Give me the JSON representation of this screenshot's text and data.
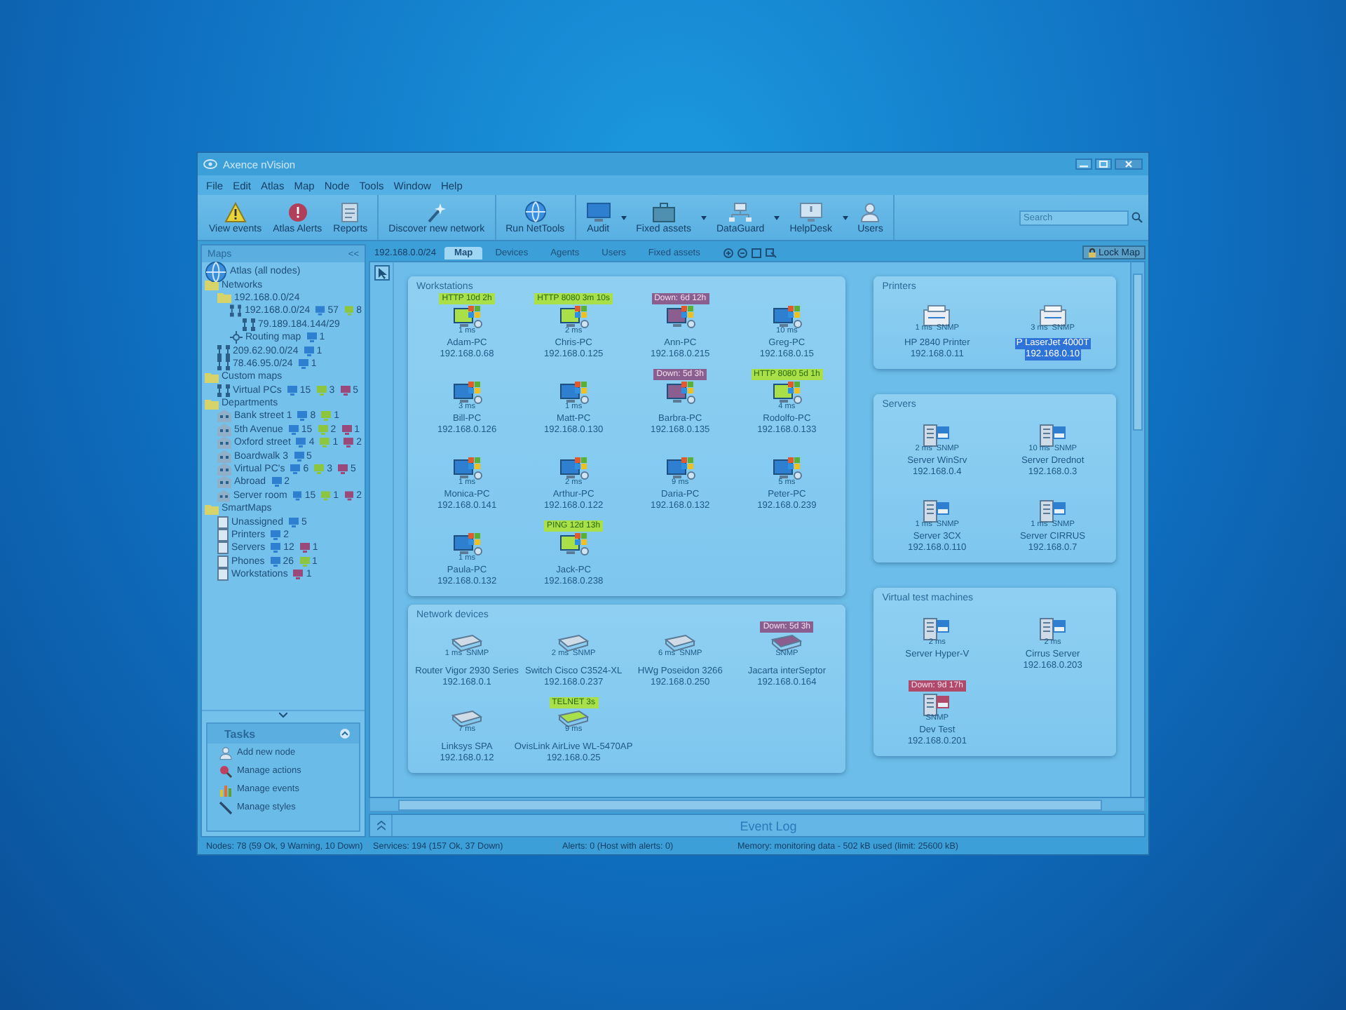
{
  "window": {
    "title": "Axence nVision"
  },
  "menu": [
    "File",
    "Edit",
    "Atlas",
    "Map",
    "Node",
    "Tools",
    "Window",
    "Help"
  ],
  "toolbar": [
    {
      "buttons": [
        {
          "label": "View events",
          "dropdown": false
        },
        {
          "label": "Atlas Alerts",
          "dropdown": false
        },
        {
          "label": "Reports",
          "dropdown": false
        }
      ]
    },
    {
      "buttons": [
        {
          "label": "Discover new network",
          "dropdown": false
        }
      ]
    },
    {
      "buttons": [
        {
          "label": "Run NetTools",
          "dropdown": false
        }
      ]
    },
    {
      "buttons": [
        {
          "label": "Audit",
          "dropdown": true
        },
        {
          "label": "Fixed assets",
          "dropdown": true
        },
        {
          "label": "DataGuard",
          "dropdown": true
        },
        {
          "label": "HelpDesk",
          "dropdown": true
        },
        {
          "label": "Users",
          "dropdown": false
        }
      ]
    }
  ],
  "search": {
    "placeholder": "Search"
  },
  "sidebar": {
    "title": "Maps",
    "collapse": "<<",
    "tree": [
      {
        "label": "Atlas (all nodes)",
        "kind": "globe"
      },
      {
        "label": "Networks",
        "kind": "folder",
        "children": [
          {
            "label": "192.168.0.0/24",
            "kind": "folder",
            "children": [
              {
                "label": "192.168.0.0/24",
                "kind": "net",
                "counts": [
                  {
                    "value": "57",
                    "color": "#2f7fd0"
                  },
                  {
                    "value": "8",
                    "color": "#8cc63f"
                  }
                ],
                "children": [
                  {
                    "label": "79.189.184.144/29",
                    "kind": "net"
                  }
                ]
              },
              {
                "label": "Routing map",
                "kind": "routing",
                "counts": [
                  {
                    "value": "1",
                    "color": "#2f7fd0"
                  }
                ]
              }
            ]
          },
          {
            "label": "209.62.90.0/24",
            "kind": "net",
            "counts": [
              {
                "value": "1",
                "color": "#2f7fd0"
              }
            ]
          },
          {
            "label": "78.46.95.0/24",
            "kind": "net",
            "counts": [
              {
                "value": "1",
                "color": "#2f7fd0"
              }
            ]
          }
        ]
      },
      {
        "label": "Custom maps",
        "kind": "folder",
        "children": [
          {
            "label": "Virtual PCs",
            "kind": "net",
            "counts": [
              {
                "value": "15",
                "color": "#2f7fd0"
              },
              {
                "value": "3",
                "color": "#8cc63f"
              },
              {
                "value": "5",
                "color": "#9a4a7a"
              }
            ]
          }
        ]
      },
      {
        "label": "Departments",
        "kind": "folder",
        "children": [
          {
            "label": "Bank street 1",
            "kind": "building",
            "counts": [
              {
                "value": "8",
                "color": "#2f7fd0"
              },
              {
                "value": "1",
                "color": "#8cc63f"
              }
            ]
          },
          {
            "label": "5th Avenue",
            "kind": "building",
            "counts": [
              {
                "value": "15",
                "color": "#2f7fd0"
              },
              {
                "value": "2",
                "color": "#8cc63f"
              },
              {
                "value": "1",
                "color": "#9a4a7a"
              }
            ]
          },
          {
            "label": "Oxford street",
            "kind": "building",
            "counts": [
              {
                "value": "4",
                "color": "#2f7fd0"
              },
              {
                "value": "1",
                "color": "#8cc63f"
              },
              {
                "value": "2",
                "color": "#9a4a7a"
              }
            ]
          },
          {
            "label": "Boardwalk 3",
            "kind": "building",
            "counts": [
              {
                "value": "5",
                "color": "#2f7fd0"
              }
            ]
          },
          {
            "label": "Virtual PC's",
            "kind": "building",
            "counts": [
              {
                "value": "6",
                "color": "#2f7fd0"
              },
              {
                "value": "3",
                "color": "#8cc63f"
              },
              {
                "value": "5",
                "color": "#9a4a7a"
              }
            ]
          },
          {
            "label": "Abroad",
            "kind": "building",
            "counts": [
              {
                "value": "2",
                "color": "#2f7fd0"
              }
            ]
          },
          {
            "label": "Server room",
            "kind": "building",
            "counts": [
              {
                "value": "15",
                "color": "#2f7fd0"
              },
              {
                "value": "1",
                "color": "#8cc63f"
              },
              {
                "value": "2",
                "color": "#9a4a7a"
              }
            ]
          }
        ]
      },
      {
        "label": "SmartMaps",
        "kind": "folder",
        "children": [
          {
            "label": "Unassigned",
            "kind": "page",
            "counts": [
              {
                "value": "5",
                "color": "#2f7fd0"
              }
            ]
          },
          {
            "label": "Printers",
            "kind": "page",
            "counts": [
              {
                "value": "2",
                "color": "#2f7fd0"
              }
            ]
          },
          {
            "label": "Servers",
            "kind": "page",
            "counts": [
              {
                "value": "12",
                "color": "#2f7fd0"
              },
              {
                "value": "1",
                "color": "#9a4a7a"
              }
            ]
          },
          {
            "label": "Phones",
            "kind": "page",
            "counts": [
              {
                "value": "26",
                "color": "#2f7fd0"
              },
              {
                "value": "1",
                "color": "#8cc63f"
              }
            ]
          },
          {
            "label": "Workstations",
            "kind": "page",
            "counts": [
              {
                "value": "1",
                "color": "#9a4a7a"
              }
            ]
          }
        ]
      }
    ]
  },
  "tasks": {
    "title": "Tasks",
    "items": [
      "Add new node",
      "Manage actions",
      "Manage events",
      "Manage styles"
    ]
  },
  "map": {
    "path": "192.168.0.0/24",
    "tabs": [
      {
        "label": "Map",
        "selected": true
      },
      {
        "label": "Devices",
        "selected": false
      },
      {
        "label": "Agents",
        "selected": false
      },
      {
        "label": "Users",
        "selected": false
      },
      {
        "label": "Fixed assets",
        "selected": false
      }
    ],
    "lock_button": "Lock Map",
    "columns": [
      {
        "groups": [
          {
            "title": "Workstations",
            "nodes": [
              {
                "name": "Adam-PC",
                "ip": "192.168.0.68",
                "ping": "1 ms",
                "badge": {
                  "text": "HTTP 10d 2h",
                  "color": "#a9e04a"
                },
                "kind": "workstation",
                "selected": false
              },
              {
                "name": "Chris-PC",
                "ip": "192.168.0.125",
                "ping": "2 ms",
                "badge": {
                  "text": "HTTP 8080 3m 10s",
                  "color": "#a9e04a"
                },
                "kind": "workstation",
                "selected": false
              },
              {
                "name": "Ann-PC",
                "ip": "192.168.0.215",
                "badge": {
                  "text": "Down: 6d 12h",
                  "color": "#8a5f8f"
                },
                "kind": "workstation",
                "selected": false
              },
              {
                "name": "Greg-PC",
                "ip": "192.168.0.15",
                "ping": "10 ms",
                "kind": "workstation",
                "selected": false
              },
              {
                "name": "Bill-PC",
                "ip": "192.168.0.126",
                "ping": "3 ms",
                "kind": "workstation",
                "selected": false
              },
              {
                "name": "Matt-PC",
                "ip": "192.168.0.130",
                "ping": "1 ms",
                "kind": "workstation",
                "selected": false
              },
              {
                "name": "Barbra-PC",
                "ip": "192.168.0.135",
                "badge": {
                  "text": "Down: 5d 3h",
                  "color": "#8a5f8f"
                },
                "kind": "workstation",
                "selected": false
              },
              {
                "name": "Rodolfo-PC",
                "ip": "192.168.0.133",
                "ping": "4 ms",
                "badge": {
                  "text": "HTTP 8080 5d 1h",
                  "color": "#a9e04a"
                },
                "kind": "workstation",
                "selected": false
              },
              {
                "name": "Monica-PC",
                "ip": "192.168.0.141",
                "ping": "1 ms",
                "kind": "workstation",
                "selected": false
              },
              {
                "name": "Arthur-PC",
                "ip": "192.168.0.122",
                "ping": "2 ms",
                "kind": "workstation",
                "selected": false
              },
              {
                "name": "Daria-PC",
                "ip": "192.168.0.132",
                "ping": "9 ms",
                "kind": "workstation",
                "selected": false
              },
              {
                "name": "Peter-PC",
                "ip": "192.168.0.239",
                "ping": "5 ms",
                "kind": "workstation",
                "selected": false
              },
              {
                "name": "Paula-PC",
                "ip": "192.168.0.132",
                "ping": "1 ms",
                "kind": "workstation",
                "selected": false
              },
              {
                "name": "Jack-PC",
                "ip": "192.168.0.238",
                "badge": {
                  "text": "PING 12d 13h",
                  "color": "#a9e04a"
                },
                "kind": "workstation",
                "selected": false
              }
            ]
          },
          {
            "title": "Network devices",
            "nodes": [
              {
                "name": "Router Vigor 2930 Series",
                "ip": "192.168.0.1",
                "ping": "1 ms",
                "tag": "SNMP",
                "kind": "router",
                "selected": false
              },
              {
                "name": "Switch Cisco C3524-XL",
                "ip": "192.168.0.237",
                "ping": "2 ms",
                "tag": "SNMP",
                "kind": "router",
                "selected": false
              },
              {
                "name": "HWg Poseidon 3266",
                "ip": "192.168.0.250",
                "ping": "6 ms",
                "tag": "SNMP",
                "kind": "router",
                "selected": false
              },
              {
                "name": "Jacarta interSeptor",
                "ip": "192.168.0.164",
                "tag": "SNMP",
                "badge": {
                  "text": "Down: 5d 3h",
                  "color": "#8a5f8f"
                },
                "kind": "router",
                "selected": false
              },
              {
                "name": "Linksys SPA",
                "ip": "192.168.0.12",
                "ping": "7 ms",
                "kind": "router",
                "selected": false
              },
              {
                "name": "OvisLink AirLive WL-5470AP",
                "ip": "192.168.0.25",
                "ping": "9 ms",
                "badge": {
                  "text": "TELNET 3s",
                  "color": "#a9e04a"
                },
                "kind": "router",
                "selected": false
              }
            ]
          }
        ]
      },
      {
        "groups": [
          {
            "title": "Printers",
            "nodes": [
              {
                "name": "HP 2840 Printer",
                "ip": "192.168.0.11",
                "ping": "1 ms",
                "tag": "SNMP",
                "kind": "printer",
                "selected": false
              },
              {
                "name": "P LaserJet 4000T",
                "ip": "192.168.0.10",
                "ping": "3 ms",
                "tag": "SNMP",
                "kind": "printer",
                "selected": true
              }
            ]
          },
          {
            "title": "Servers",
            "nodes": [
              {
                "name": "Server WinSrv",
                "ip": "192.168.0.4",
                "ping": "2 ms",
                "tag": "SNMP",
                "kind": "server",
                "selected": false
              },
              {
                "name": "Server Drednot",
                "ip": "192.168.0.3",
                "ping": "10 ms",
                "tag": "SNMP",
                "kind": "server",
                "selected": false
              },
              {
                "name": "Server 3CX",
                "ip": "192.168.0.110",
                "ping": "1 ms",
                "tag": "SNMP",
                "kind": "server",
                "selected": false
              },
              {
                "name": "Server CIRRUS",
                "ip": "192.168.0.7",
                "ping": "1 ms",
                "tag": "SNMP",
                "kind": "server",
                "selected": false
              }
            ]
          },
          {
            "title": "Virtual test machines",
            "nodes": [
              {
                "name": "Server Hyper-V",
                "ping": "2 ms",
                "kind": "server",
                "selected": false
              },
              {
                "name": "Cirrus Server",
                "ip": "192.168.0.203",
                "ping": "2 ms",
                "kind": "server",
                "selected": false
              },
              {
                "name": "Dev Test",
                "ip": "192.168.0.201",
                "tag": "SNMP",
                "badge": {
                  "text": "Down: 9d 17h",
                  "color": "#b04a6a"
                },
                "kind": "server",
                "selected": false
              }
            ]
          }
        ]
      }
    ]
  },
  "event_log": {
    "title": "Event Log"
  },
  "status_bar": [
    "Nodes: 78 (59 Ok, 9 Warning, 10 Down)",
    "Services: 194 (157 Ok, 37 Down)",
    "Alerts: 0 (Host with alerts: 0)",
    "Memory: monitoring data - 502 kB used (limit: 25600 kB)"
  ]
}
